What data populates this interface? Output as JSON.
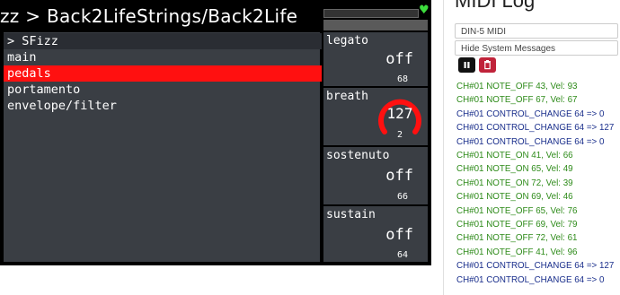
{
  "device": {
    "title": "zz > Back2LifeStrings/Back2Life",
    "list": [
      {
        "label": "> SFizz",
        "kind": "header"
      },
      {
        "label": "main",
        "kind": "normal"
      },
      {
        "label": "pedals",
        "kind": "selected"
      },
      {
        "label": "portamento",
        "kind": "normal"
      },
      {
        "label": "envelope/filter",
        "kind": "normal"
      }
    ],
    "controls": {
      "legato": {
        "name": "legato",
        "state": "off",
        "cc": "68"
      },
      "breath": {
        "name": "breath",
        "value": "127",
        "cc": "2"
      },
      "sostenuto": {
        "name": "sostenuto",
        "state": "off",
        "cc": "66"
      },
      "sustain": {
        "name": "sustain",
        "state": "off",
        "cc": "64"
      }
    },
    "colors": {
      "selected": "#ff1010",
      "panel": "#3a3e44",
      "gauge": "#ff1010",
      "heart": "#3ddc3d"
    },
    "icons": {
      "status": "heart-icon"
    }
  },
  "midi_log": {
    "title": "MIDI Log",
    "input_select": "DIN-5 MIDI",
    "hide_label": "Hide System Messages",
    "icons": {
      "pause": "pause-icon",
      "clear": "trash-icon"
    },
    "entries": [
      {
        "text": "CH#01 NOTE_OFF 43, Vel: 93",
        "color": "#2e8b1a"
      },
      {
        "text": "CH#01 NOTE_OFF 67, Vel: 67",
        "color": "#2e8b1a"
      },
      {
        "text": "CH#01 CONTROL_CHANGE 64 => 0",
        "color": "#1a2f8c"
      },
      {
        "text": "CH#01 CONTROL_CHANGE 64 => 127",
        "color": "#1a2f8c"
      },
      {
        "text": "CH#01 CONTROL_CHANGE 64 => 0",
        "color": "#1a2f8c"
      },
      {
        "text": "CH#01 NOTE_ON 41, Vel: 66",
        "color": "#2e8b1a"
      },
      {
        "text": "CH#01 NOTE_ON 65, Vel: 49",
        "color": "#2e8b1a"
      },
      {
        "text": "CH#01 NOTE_ON 72, Vel: 39",
        "color": "#2e8b1a"
      },
      {
        "text": "CH#01 NOTE_ON 69, Vel: 46",
        "color": "#2e8b1a"
      },
      {
        "text": "CH#01 NOTE_OFF 65, Vel: 76",
        "color": "#2e8b1a"
      },
      {
        "text": "CH#01 NOTE_OFF 69, Vel: 79",
        "color": "#2e8b1a"
      },
      {
        "text": "CH#01 NOTE_OFF 72, Vel: 61",
        "color": "#2e8b1a"
      },
      {
        "text": "CH#01 NOTE_OFF 41, Vel: 96",
        "color": "#2e8b1a"
      },
      {
        "text": "CH#01 CONTROL_CHANGE 64 => 127",
        "color": "#1a2f8c"
      },
      {
        "text": "CH#01 CONTROL_CHANGE 64 => 0",
        "color": "#1a2f8c"
      }
    ]
  }
}
